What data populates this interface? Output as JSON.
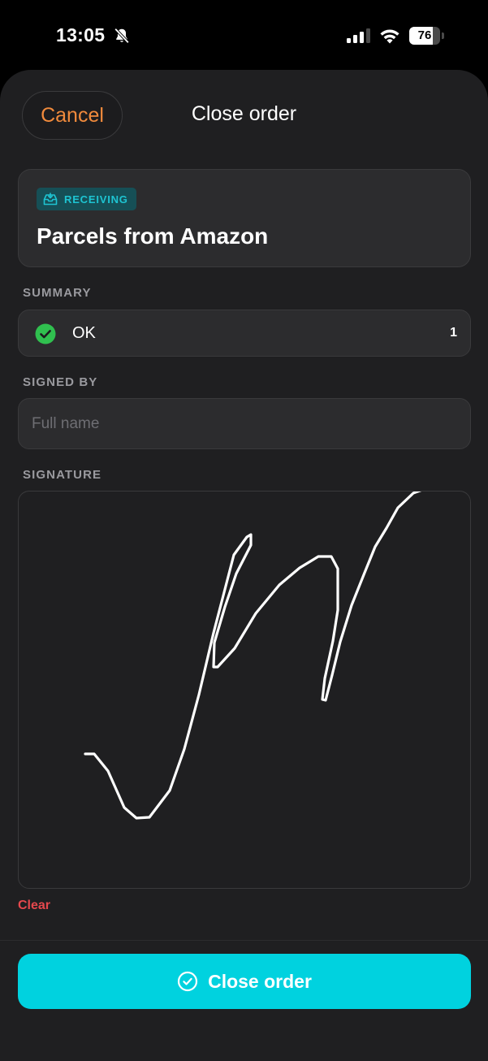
{
  "status_bar": {
    "time": "13:05",
    "battery_level": "76",
    "battery_fraction": 0.76,
    "icons": [
      "bell-slash-icon",
      "signal-icon",
      "wifi-icon",
      "battery-icon"
    ]
  },
  "header": {
    "cancel_label": "Cancel",
    "title": "Close order"
  },
  "order": {
    "type_badge": "RECEIVING",
    "type_icon": "inbox-icon",
    "title": "Parcels from Amazon"
  },
  "summary": {
    "section_label": "SUMMARY",
    "status_icon": "check-circle-icon",
    "status_label": "OK",
    "count": "1"
  },
  "signed_by": {
    "section_label": "SIGNED BY",
    "placeholder": "Full name",
    "value": ""
  },
  "signature": {
    "section_label": "SIGNATURE",
    "clear_label": "Clear"
  },
  "footer": {
    "button_icon": "check-circle-outline-icon",
    "button_label": "Close order"
  },
  "colors": {
    "accent": "#00d2df",
    "cancel": "#f08a3c",
    "badge_text": "#1ec4d2",
    "badge_bg": "#164f56",
    "success": "#30c04f",
    "destructive": "#e5484d",
    "surface": "#2c2c2e",
    "background": "#1f1f21"
  }
}
